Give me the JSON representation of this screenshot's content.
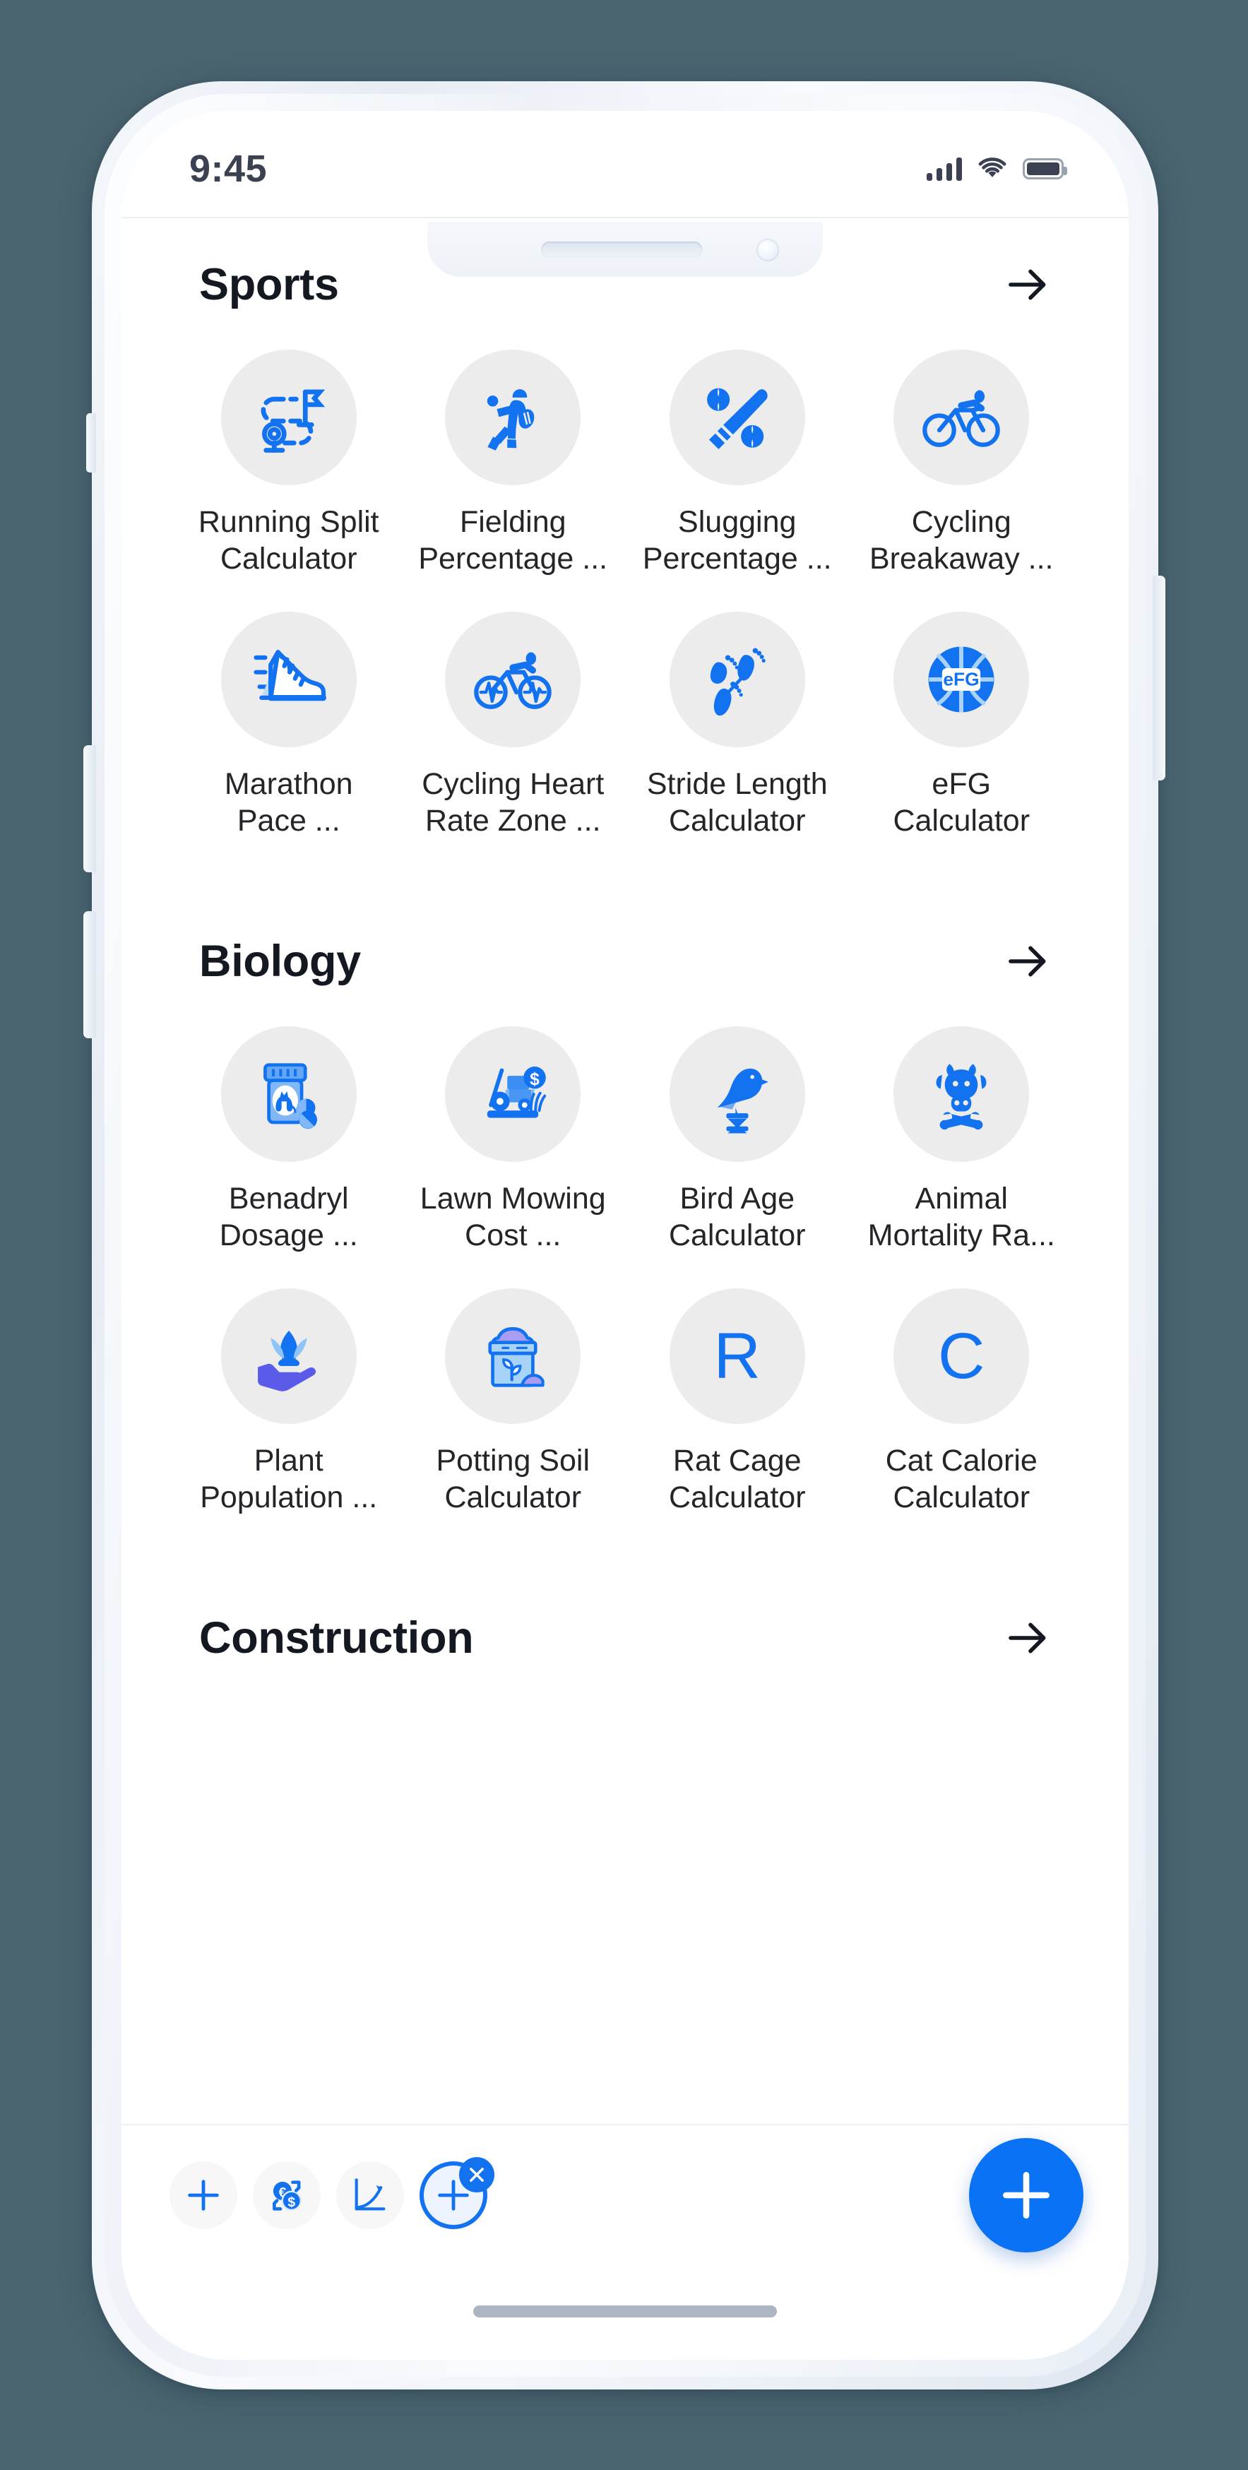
{
  "statusbar": {
    "time": "9:45",
    "signal_icon": "signal-bars-icon",
    "wifi_icon": "wifi-icon",
    "battery_icon": "battery-full-icon"
  },
  "sections": [
    {
      "title": "Sports",
      "arrow_icon": "arrow-right-icon",
      "tiles": [
        {
          "label": "Running Split\nCalculator",
          "icon": "running-route-flag-icon"
        },
        {
          "label": "Fielding\nPercentage ...",
          "icon": "baseball-fielder-icon"
        },
        {
          "label": "Slugging\nPercentage ...",
          "icon": "baseball-bat-balls-icon"
        },
        {
          "label": "Cycling\nBreakaway ...",
          "icon": "cyclist-icon"
        },
        {
          "label": "Marathon\nPace ...",
          "icon": "running-shoe-icon"
        },
        {
          "label": "Cycling Heart\nRate Zone ...",
          "icon": "cyclist-heartrate-icon"
        },
        {
          "label": "Stride Length\nCalculator",
          "icon": "footprints-icon"
        },
        {
          "label": "eFG\nCalculator",
          "icon": "basketball-efg-icon",
          "badge_text": "eFG"
        }
      ]
    },
    {
      "title": "Biology",
      "arrow_icon": "arrow-right-icon",
      "tiles": [
        {
          "label": "Benadryl\nDosage ...",
          "icon": "pill-bottle-cat-icon"
        },
        {
          "label": "Lawn Mowing\nCost ...",
          "icon": "lawn-mower-dollar-icon"
        },
        {
          "label": "Bird Age\nCalculator",
          "icon": "bird-hourglass-icon"
        },
        {
          "label": "Animal\nMortality Ra...",
          "icon": "cow-crossbones-icon"
        },
        {
          "label": "Plant\nPopulation ...",
          "icon": "hand-plant-icon"
        },
        {
          "label": "Potting Soil\nCalculator",
          "icon": "soil-bag-sprout-icon"
        },
        {
          "label": "Rat Cage\nCalculator",
          "icon": "letter-r-icon",
          "letter": "R"
        },
        {
          "label": "Cat Calorie\nCalculator",
          "icon": "letter-c-icon",
          "letter": "C"
        }
      ]
    },
    {
      "title": "Construction",
      "arrow_icon": "arrow-right-icon",
      "tiles": []
    }
  ],
  "bottombar": {
    "minis": [
      {
        "icon": "plus-icon",
        "active": false
      },
      {
        "icon": "currency-exchange-icon",
        "active": false
      },
      {
        "icon": "growth-chart-icon",
        "active": false
      },
      {
        "icon": "plus-circle-icon",
        "active": true,
        "badge_icon": "close-x-icon"
      }
    ],
    "fab_icon": "plus-icon"
  },
  "colors": {
    "accent": "#1272f0",
    "accent_fab": "#0a72f5",
    "icon_bg": "#ececec",
    "label_text": "#232528",
    "title_text": "#141821",
    "page_bg": "#4a6570"
  }
}
